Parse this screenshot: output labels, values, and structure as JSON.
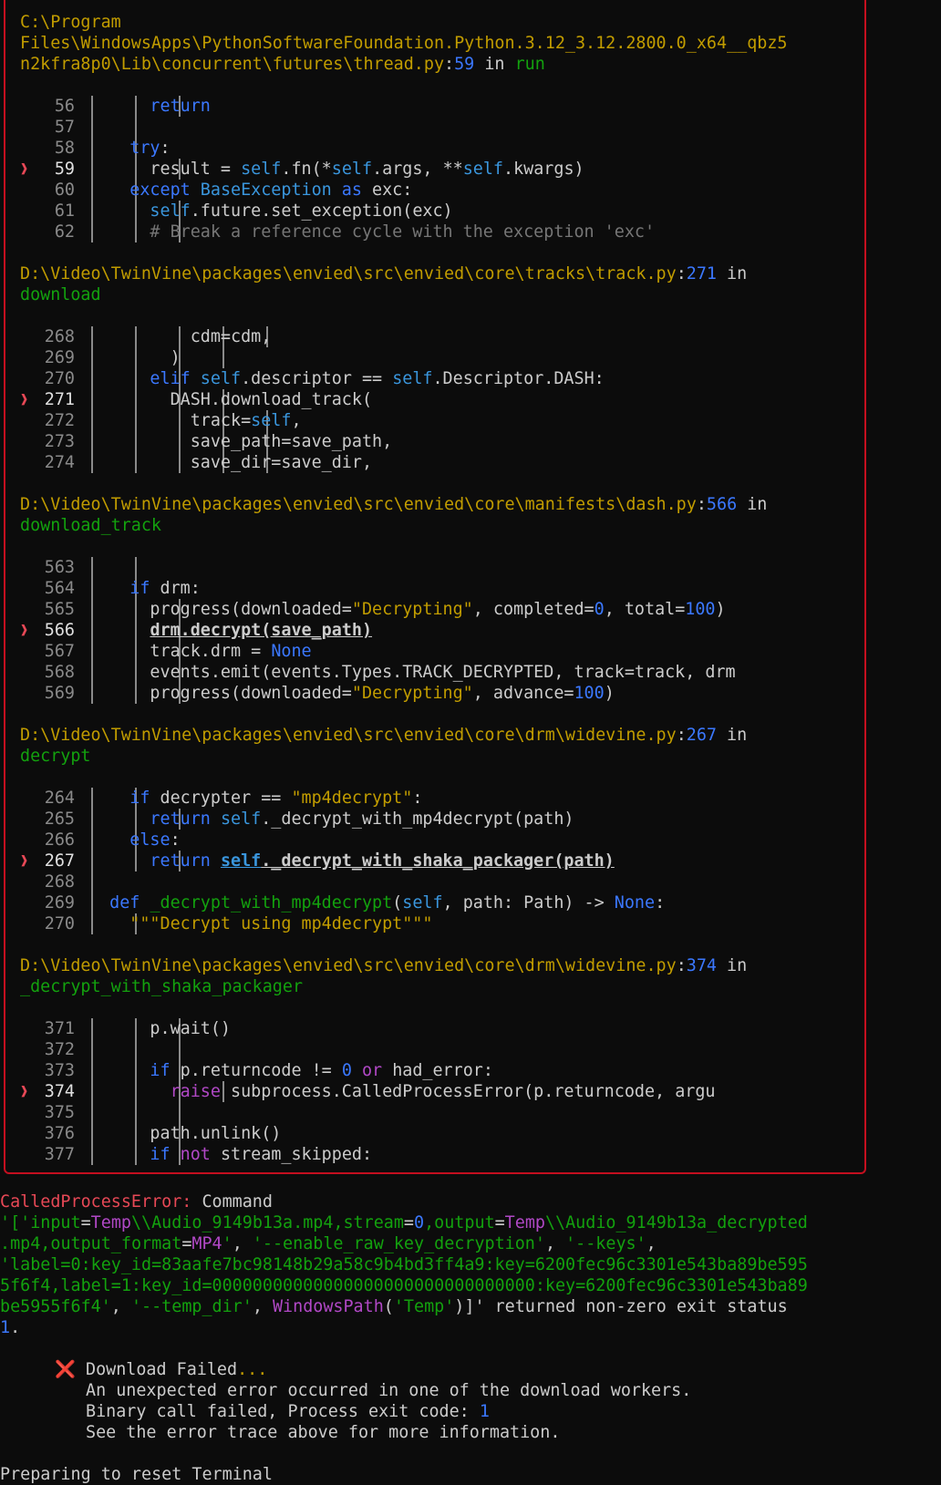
{
  "frames": [
    {
      "header": [
        [
          {
            "t": "C:\\Program",
            "c": "path"
          }
        ],
        [
          {
            "t": "Files\\WindowsApps\\PythonSoftwareFoundation.Python.3.12_3.12.2800.0_x64__qbz5",
            "c": "path"
          }
        ],
        [
          {
            "t": "n2kfra8p0\\Lib\\concurrent\\futures\\thread.py",
            "c": "path"
          },
          {
            "t": ":",
            "c": ""
          },
          {
            "t": "59",
            "c": "num"
          },
          {
            "t": " in ",
            "c": ""
          },
          {
            "t": "run",
            "c": "func"
          }
        ]
      ],
      "lines": [
        {
          "n": "56",
          "g": 3,
          "code": [
            {
              "t": "      return",
              "c": "kw"
            }
          ]
        },
        {
          "n": "57",
          "g": 2,
          "code": []
        },
        {
          "n": "58",
          "g": 2,
          "code": [
            {
              "t": "    try",
              "c": "kw"
            },
            {
              "t": ":",
              "c": ""
            }
          ]
        },
        {
          "n": "59",
          "g": 3,
          "cur": true,
          "code": [
            {
              "t": "      result = ",
              "c": ""
            },
            {
              "t": "self",
              "c": "self"
            },
            {
              "t": ".fn(*",
              "c": ""
            },
            {
              "t": "self",
              "c": "self"
            },
            {
              "t": ".args, **",
              "c": ""
            },
            {
              "t": "self",
              "c": "self"
            },
            {
              "t": ".kwargs)",
              "c": ""
            }
          ]
        },
        {
          "n": "60",
          "g": 2,
          "code": [
            {
              "t": "    except ",
              "c": "kw"
            },
            {
              "t": "BaseException",
              "c": "self"
            },
            {
              "t": " as ",
              "c": "kw"
            },
            {
              "t": "exc:",
              "c": ""
            }
          ]
        },
        {
          "n": "61",
          "g": 3,
          "code": [
            {
              "t": "      self",
              "c": "self"
            },
            {
              "t": ".future.set_exception(exc)",
              "c": ""
            }
          ]
        },
        {
          "n": "62",
          "g": 3,
          "code": [
            {
              "t": "      # Break a reference cycle with the exception 'exc'",
              "c": "cm"
            }
          ]
        }
      ]
    },
    {
      "header": [
        [
          {
            "t": "D:\\Video\\TwinVine\\packages\\envied\\src\\envied\\core\\tracks\\track.py",
            "c": "path"
          },
          {
            "t": ":",
            "c": ""
          },
          {
            "t": "271",
            "c": "num"
          },
          {
            "t": " in",
            "c": ""
          }
        ],
        [
          {
            "t": "download",
            "c": "func"
          }
        ]
      ],
      "lines": [
        {
          "n": "268",
          "g": 5,
          "code": [
            {
              "t": "          cdm=cdm,",
              "c": ""
            }
          ]
        },
        {
          "n": "269",
          "g": 4,
          "code": [
            {
              "t": "        )",
              "c": ""
            }
          ]
        },
        {
          "n": "270",
          "g": 3,
          "code": [
            {
              "t": "      elif ",
              "c": "kw"
            },
            {
              "t": "self",
              "c": "self"
            },
            {
              "t": ".descriptor == ",
              "c": ""
            },
            {
              "t": "self",
              "c": "self"
            },
            {
              "t": ".Descriptor.DASH:",
              "c": ""
            }
          ]
        },
        {
          "n": "271",
          "g": 4,
          "cur": true,
          "code": [
            {
              "t": "        DASH.download_track(",
              "c": ""
            }
          ]
        },
        {
          "n": "272",
          "g": 5,
          "code": [
            {
              "t": "          track=",
              "c": ""
            },
            {
              "t": "self",
              "c": "self"
            },
            {
              "t": ",",
              "c": ""
            }
          ]
        },
        {
          "n": "273",
          "g": 5,
          "code": [
            {
              "t": "          save_path=save_path,",
              "c": ""
            }
          ]
        },
        {
          "n": "274",
          "g": 5,
          "code": [
            {
              "t": "          save_dir=save_dir,",
              "c": ""
            }
          ]
        }
      ]
    },
    {
      "header": [
        [
          {
            "t": "D:\\Video\\TwinVine\\packages\\envied\\src\\envied\\core\\manifests\\dash.py",
            "c": "path"
          },
          {
            "t": ":",
            "c": ""
          },
          {
            "t": "566",
            "c": "num"
          },
          {
            "t": " in",
            "c": ""
          }
        ],
        [
          {
            "t": "download_track",
            "c": "func"
          }
        ]
      ],
      "lines": [
        {
          "n": "563",
          "g": 2,
          "code": []
        },
        {
          "n": "564",
          "g": 2,
          "code": [
            {
              "t": "    if ",
              "c": "kw"
            },
            {
              "t": "drm:",
              "c": ""
            }
          ]
        },
        {
          "n": "565",
          "g": 3,
          "code": [
            {
              "t": "      progress(downloaded=",
              "c": ""
            },
            {
              "t": "\"Decrypting\"",
              "c": "str"
            },
            {
              "t": ", completed=",
              "c": ""
            },
            {
              "t": "0",
              "c": "num"
            },
            {
              "t": ", total=",
              "c": ""
            },
            {
              "t": "100",
              "c": "num"
            },
            {
              "t": ")",
              "c": ""
            }
          ]
        },
        {
          "n": "566",
          "g": 3,
          "cur": true,
          "code": [
            {
              "t": "      ",
              "c": ""
            },
            {
              "t": "drm.decrypt(save_path)",
              "c": "hl"
            }
          ]
        },
        {
          "n": "567",
          "g": 3,
          "code": [
            {
              "t": "      track.drm = ",
              "c": ""
            },
            {
              "t": "None",
              "c": "kw"
            }
          ]
        },
        {
          "n": "568",
          "g": 3,
          "code": [
            {
              "t": "      events.emit(events.Types.TRACK_DECRYPTED, track=track, drm",
              "c": ""
            }
          ]
        },
        {
          "n": "569",
          "g": 3,
          "code": [
            {
              "t": "      progress(downloaded=",
              "c": ""
            },
            {
              "t": "\"Decrypting\"",
              "c": "str"
            },
            {
              "t": ", advance=",
              "c": ""
            },
            {
              "t": "100",
              "c": "num"
            },
            {
              "t": ")",
              "c": ""
            }
          ]
        }
      ]
    },
    {
      "header": [
        [
          {
            "t": "D:\\Video\\TwinVine\\packages\\envied\\src\\envied\\core\\drm\\widevine.py",
            "c": "path"
          },
          {
            "t": ":",
            "c": ""
          },
          {
            "t": "267",
            "c": "num"
          },
          {
            "t": " in",
            "c": ""
          }
        ],
        [
          {
            "t": "decrypt",
            "c": "func"
          }
        ]
      ],
      "lines": [
        {
          "n": "264",
          "g": 2,
          "code": [
            {
              "t": "    if ",
              "c": "kw"
            },
            {
              "t": "decrypter == ",
              "c": ""
            },
            {
              "t": "\"mp4decrypt\"",
              "c": "str"
            },
            {
              "t": ":",
              "c": ""
            }
          ]
        },
        {
          "n": "265",
          "g": 3,
          "code": [
            {
              "t": "      return ",
              "c": "kw"
            },
            {
              "t": "self",
              "c": "self"
            },
            {
              "t": "._decrypt_with_mp4decrypt(path)",
              "c": ""
            }
          ]
        },
        {
          "n": "266",
          "g": 2,
          "code": [
            {
              "t": "    else",
              "c": "kw"
            },
            {
              "t": ":",
              "c": ""
            }
          ]
        },
        {
          "n": "267",
          "g": 3,
          "cur": true,
          "code": [
            {
              "t": "      return ",
              "c": "kw"
            },
            {
              "t": "self",
              "c": "self hl"
            },
            {
              "t": "._decrypt_with_shaka_packager(path)",
              "c": "hl"
            }
          ]
        },
        {
          "n": "268",
          "g": 1,
          "code": []
        },
        {
          "n": "269",
          "g": 1,
          "code": [
            {
              "t": "  def ",
              "c": "kw"
            },
            {
              "t": "_decrypt_with_mp4decrypt",
              "c": "func"
            },
            {
              "t": "(",
              "c": ""
            },
            {
              "t": "self",
              "c": "self"
            },
            {
              "t": ", path: Path) -> ",
              "c": ""
            },
            {
              "t": "None",
              "c": "kw"
            },
            {
              "t": ":",
              "c": ""
            }
          ]
        },
        {
          "n": "270",
          "g": 2,
          "code": [
            {
              "t": "    \"\"\"Decrypt using mp4decrypt\"\"\"",
              "c": "str"
            }
          ]
        }
      ]
    },
    {
      "header": [
        [
          {
            "t": "D:\\Video\\TwinVine\\packages\\envied\\src\\envied\\core\\drm\\widevine.py",
            "c": "path"
          },
          {
            "t": ":",
            "c": ""
          },
          {
            "t": "374",
            "c": "num"
          },
          {
            "t": " in",
            "c": ""
          }
        ],
        [
          {
            "t": "_decrypt_with_shaka_packager",
            "c": "func"
          }
        ]
      ],
      "lines": [
        {
          "n": "371",
          "g": 3,
          "code": [
            {
              "t": "      p.wait()",
              "c": ""
            }
          ]
        },
        {
          "n": "372",
          "g": 3,
          "code": []
        },
        {
          "n": "373",
          "g": 3,
          "code": [
            {
              "t": "      if ",
              "c": "kw"
            },
            {
              "t": "p.returncode != ",
              "c": ""
            },
            {
              "t": "0",
              "c": "num"
            },
            {
              "t": " or ",
              "c": "kw2"
            },
            {
              "t": "had_error:",
              "c": ""
            }
          ]
        },
        {
          "n": "374",
          "g": 4,
          "cur": true,
          "code": [
            {
              "t": "        raise ",
              "c": "kw2"
            },
            {
              "t": "subprocess.CalledProcessError(p.returncode, argu",
              "c": ""
            }
          ]
        },
        {
          "n": "375",
          "g": 3,
          "code": []
        },
        {
          "n": "376",
          "g": 3,
          "code": [
            {
              "t": "      path.unlink()",
              "c": ""
            }
          ]
        },
        {
          "n": "377",
          "g": 3,
          "code": [
            {
              "t": "      if ",
              "c": "kw"
            },
            {
              "t": "not ",
              "c": "kw2"
            },
            {
              "t": "stream_skipped:",
              "c": ""
            }
          ]
        }
      ]
    }
  ],
  "error_lines": [
    [
      {
        "t": "CalledProcessError:",
        "c": "err"
      },
      {
        "t": " Command",
        "c": ""
      }
    ],
    [
      {
        "t": "'['",
        "c": "g"
      },
      {
        "t": "input",
        "c": "g"
      },
      {
        "t": "=",
        "c": ""
      },
      {
        "t": "Temp",
        "c": "m"
      },
      {
        "t": "\\\\Audio_9149b13a.mp4,",
        "c": "g"
      },
      {
        "t": "stream",
        "c": "g"
      },
      {
        "t": "=",
        "c": ""
      },
      {
        "t": "0",
        "c": "num"
      },
      {
        "t": ",",
        "c": "g"
      },
      {
        "t": "output",
        "c": "g"
      },
      {
        "t": "=",
        "c": ""
      },
      {
        "t": "Temp",
        "c": "m"
      },
      {
        "t": "\\\\Audio_9149b13a_decrypted",
        "c": "g"
      }
    ],
    [
      {
        "t": ".mp4,",
        "c": "g"
      },
      {
        "t": "output_format",
        "c": "g"
      },
      {
        "t": "=",
        "c": ""
      },
      {
        "t": "MP4",
        "c": "m"
      },
      {
        "t": "'",
        "c": "g"
      },
      {
        "t": ", ",
        "c": ""
      },
      {
        "t": "'--enable_raw_key_decryption'",
        "c": "g"
      },
      {
        "t": ", ",
        "c": ""
      },
      {
        "t": "'--keys'",
        "c": "g"
      },
      {
        "t": ",",
        "c": ""
      }
    ],
    [
      {
        "t": "'label=0:key_id=83aafe7bc98148b29a58c9b4bd3ff4a9:key=6200fec96c3301e543ba89be595",
        "c": "g"
      }
    ],
    [
      {
        "t": "5f6f4,label=1:key_id=00000000000000000000000000000000:key=6200fec96c3301e543ba89",
        "c": "g"
      }
    ],
    [
      {
        "t": "be5955f6f4'",
        "c": "g"
      },
      {
        "t": ", ",
        "c": ""
      },
      {
        "t": "'--temp_dir'",
        "c": "g"
      },
      {
        "t": ", ",
        "c": ""
      },
      {
        "t": "WindowsPath",
        "c": "m"
      },
      {
        "t": "(",
        "c": ""
      },
      {
        "t": "'Temp'",
        "c": "g"
      },
      {
        "t": ")]' returned non-zero exit status",
        "c": ""
      }
    ],
    [
      {
        "t": "1",
        "c": "num"
      },
      {
        "t": ".",
        "c": ""
      }
    ]
  ],
  "failure": {
    "icon": "x-icon",
    "icon_glyph": "❌",
    "title": "Download Failed",
    "title_suffix": "...",
    "messages": [
      [
        {
          "t": "An unexpected error occurred in one of the download workers.",
          "c": ""
        }
      ],
      [
        {
          "t": "Binary call failed, Process exit code: ",
          "c": ""
        },
        {
          "t": "1",
          "c": "num"
        }
      ],
      [
        {
          "t": "See the error trace above for more information.",
          "c": ""
        }
      ]
    ]
  },
  "footer_text": "Preparing to reset Terminal",
  "colors": {
    "background": "#0c0c0c",
    "foreground": "#cccccc",
    "border": "#c50f1f",
    "path": "#c19c00",
    "number": "#3b78ff",
    "function": "#13a10e",
    "keyword": "#3b78ff",
    "magenta": "#b148c6",
    "error": "#e74856"
  }
}
